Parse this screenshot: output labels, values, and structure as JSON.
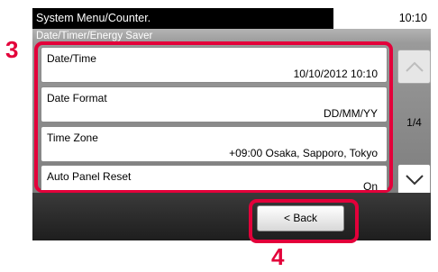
{
  "header": {
    "title": "System Menu/Counter.",
    "time": "10:10"
  },
  "subtitle": "Date/Timer/Energy Saver",
  "list": {
    "items": [
      {
        "label": "Date/Time",
        "value": "10/10/2012 10:10"
      },
      {
        "label": "Date Format",
        "value": "DD/MM/YY"
      },
      {
        "label": "Time Zone",
        "value": "+09:00 Osaka, Sapporo, Tokyo"
      },
      {
        "label": "Auto Panel Reset",
        "value": "On"
      }
    ]
  },
  "scroll": {
    "page_indicator": "1/4",
    "up_icon": "chevron-up-icon",
    "down_icon": "chevron-down-icon"
  },
  "footer": {
    "back_label": "< Back"
  },
  "callouts": {
    "list": "3",
    "back": "4"
  },
  "colors": {
    "highlight": "#e3003a",
    "header_bg": "#000000",
    "panel_bg": "#8c8c8c",
    "footer_bg": "#2a2a2a"
  }
}
